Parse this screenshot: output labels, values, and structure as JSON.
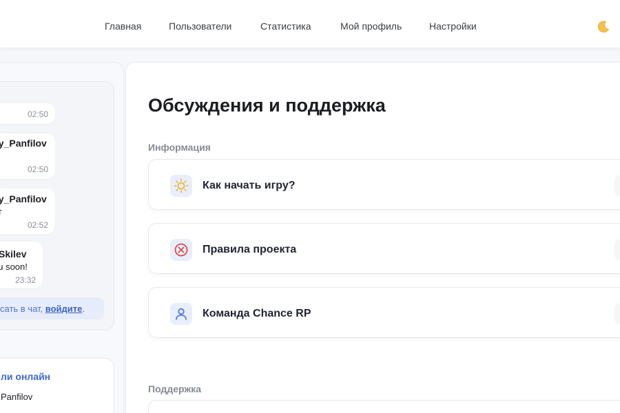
{
  "nav": {
    "items": [
      "Главная",
      "Пользователи",
      "Статистика",
      "Мой профиль",
      "Настройки"
    ]
  },
  "theme_toggle_icon": "moon-icon",
  "chat": {
    "messages": [
      {
        "author": "",
        "text": "",
        "time": "02:50"
      },
      {
        "author": "ey_Panfilov",
        "text": "",
        "time": "02:50"
      },
      {
        "author": "ey_Panfilov",
        "text": "ет",
        "time": "02:52"
      },
      {
        "author": "Skilev",
        "text": "ou soon!",
        "time": "23:32"
      }
    ],
    "login_hint_prefix": "сать в чат, ",
    "login_link": "войдите",
    "login_hint_suffix": "."
  },
  "online": {
    "title": "ли онлайн",
    "user": "Panfilov"
  },
  "main": {
    "title": "Обсуждения и поддержка",
    "sections": [
      {
        "label": "Информация",
        "items": [
          {
            "label": "Как начать игру?",
            "icon": "sun-icon"
          },
          {
            "label": "Правила проекта",
            "icon": "x-circle-icon"
          },
          {
            "label": "Команда Chance RP",
            "icon": "user-icon"
          }
        ]
      },
      {
        "label": "Поддержка",
        "items": []
      }
    ]
  },
  "colors": {
    "accent": "#3c67d6",
    "icon_bg": "#e8eefb",
    "sun": "#f2b731",
    "error": "#e04848",
    "user_icon": "#4f7be0"
  }
}
